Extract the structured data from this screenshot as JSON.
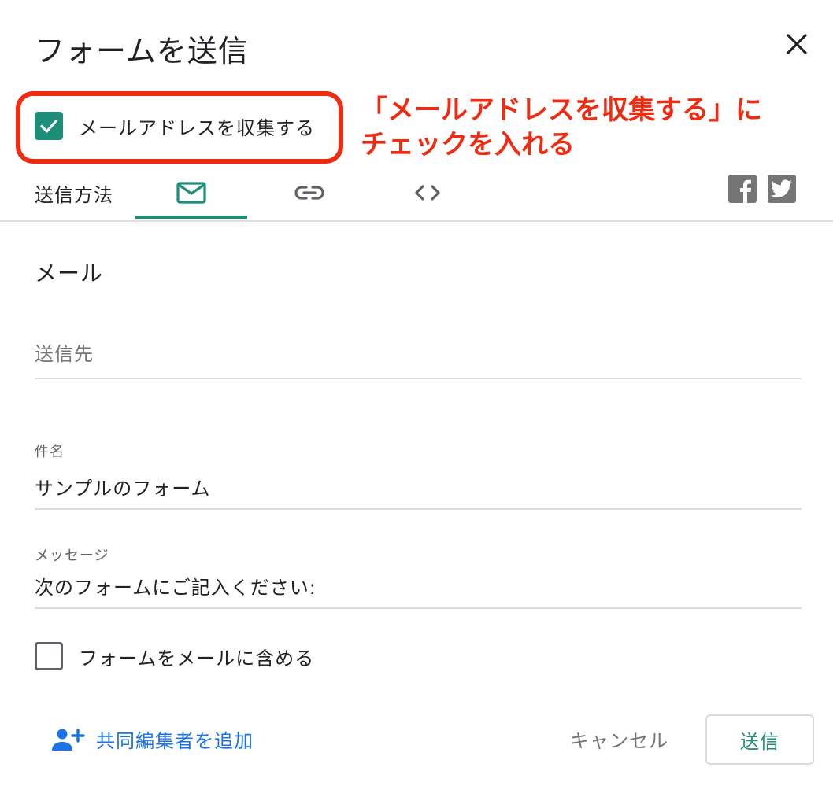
{
  "dialog": {
    "title": "フォームを送信"
  },
  "collect_email": {
    "label": "メールアドレスを収集する",
    "checked": true
  },
  "annotation": {
    "line1": "「メールアドレスを収集する」に",
    "line2": "チェックを入れる",
    "color": "#ef2b12"
  },
  "tabs": {
    "send_via_label": "送信方法",
    "items": [
      {
        "icon": "mail-icon",
        "active": true
      },
      {
        "icon": "link-icon",
        "active": false
      },
      {
        "icon": "embed-code-icon",
        "active": false
      }
    ],
    "social": [
      "facebook-icon",
      "twitter-icon"
    ]
  },
  "email": {
    "section_title": "メール",
    "to_placeholder": "送信先",
    "to_value": "",
    "subject_label": "件名",
    "subject_value": "サンプルのフォーム",
    "message_label": "メッセージ",
    "message_value": "次のフォームにご記入ください:",
    "include_form_label": "フォームをメールに含める",
    "include_form_checked": false
  },
  "footer": {
    "add_collaborators": "共同編集者を追加",
    "cancel": "キャンセル",
    "send": "送信"
  },
  "colors": {
    "accent": "#1e8e78",
    "link": "#1a73e8",
    "annotation": "#ef2b12"
  }
}
